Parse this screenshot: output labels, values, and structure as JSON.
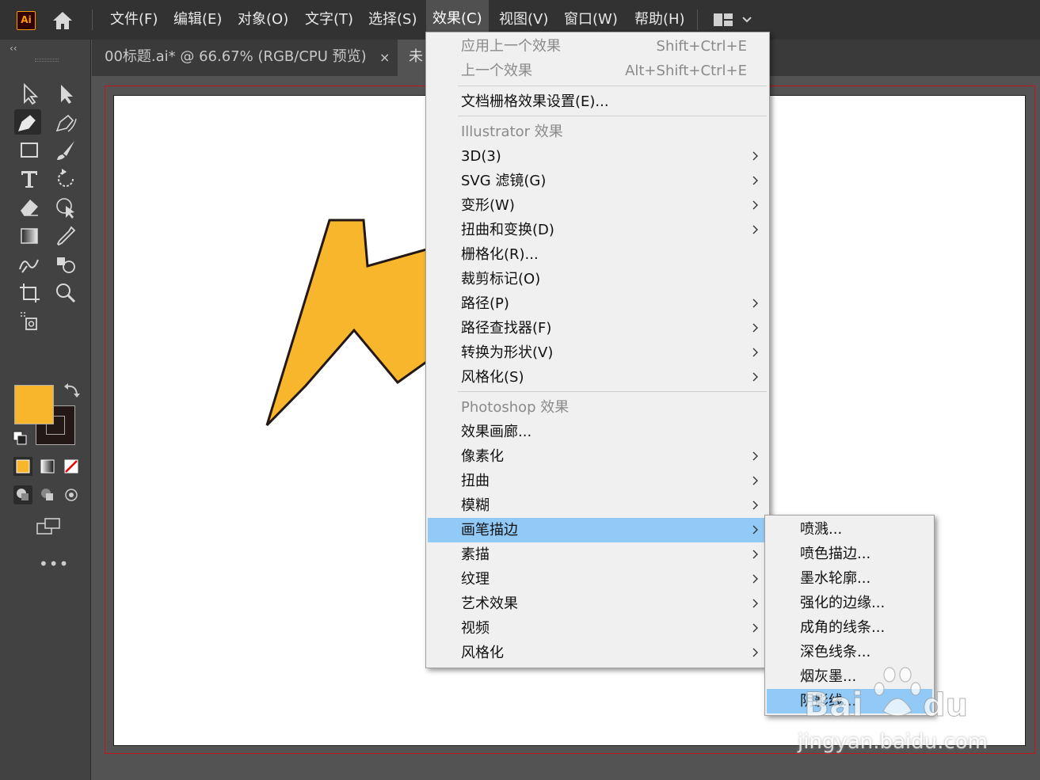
{
  "app": {
    "logo_text": "Ai"
  },
  "menubar": {
    "items": [
      {
        "label": "文件(F)"
      },
      {
        "label": "编辑(E)"
      },
      {
        "label": "对象(O)"
      },
      {
        "label": "文字(T)"
      },
      {
        "label": "选择(S)"
      },
      {
        "label": "效果(C)"
      },
      {
        "label": "视图(V)"
      },
      {
        "label": "窗口(W)"
      },
      {
        "label": "帮助(H)"
      }
    ]
  },
  "toolbar": {
    "collapse_label": "‹‹",
    "more_label": "•••",
    "fill_color": "#f8b62d",
    "stroke_color": "#231815"
  },
  "document": {
    "tab_title": "00标题.ai* @ 66.67% (RGB/CPU 预览)",
    "tab_close": "×",
    "tab2_title": "未"
  },
  "effect_menu": {
    "items": [
      {
        "label": "应用上一个效果",
        "shortcut": "Shift+Ctrl+E"
      },
      {
        "label": "上一个效果",
        "shortcut": "Alt+Shift+Ctrl+E"
      },
      {
        "label": "文档栅格效果设置(E)..."
      },
      {
        "label": "Illustrator 效果"
      },
      {
        "label": "3D(3)"
      },
      {
        "label": "SVG 滤镜(G)"
      },
      {
        "label": "变形(W)"
      },
      {
        "label": "扭曲和变换(D)"
      },
      {
        "label": "栅格化(R)..."
      },
      {
        "label": "裁剪标记(O)"
      },
      {
        "label": "路径(P)"
      },
      {
        "label": "路径查找器(F)"
      },
      {
        "label": "转换为形状(V)"
      },
      {
        "label": "风格化(S)"
      },
      {
        "label": "Photoshop 效果"
      },
      {
        "label": "效果画廊..."
      },
      {
        "label": "像素化"
      },
      {
        "label": "扭曲"
      },
      {
        "label": "模糊"
      },
      {
        "label": "画笔描边"
      },
      {
        "label": "素描"
      },
      {
        "label": "纹理"
      },
      {
        "label": "艺术效果"
      },
      {
        "label": "视频"
      },
      {
        "label": "风格化"
      }
    ]
  },
  "submenu": {
    "items": [
      {
        "label": "喷溅..."
      },
      {
        "label": "喷色描边..."
      },
      {
        "label": "墨水轮廓..."
      },
      {
        "label": "强化的边缘..."
      },
      {
        "label": "成角的线条..."
      },
      {
        "label": "深色线条..."
      },
      {
        "label": "烟灰墨..."
      },
      {
        "label": "阴影线..."
      }
    ]
  },
  "watermark": {
    "url": "jingyan.baidu.com"
  },
  "colors": {
    "highlight": "#91c9f7",
    "artboard_border": "#c4161c",
    "shape_fill": "#f8b62d"
  }
}
